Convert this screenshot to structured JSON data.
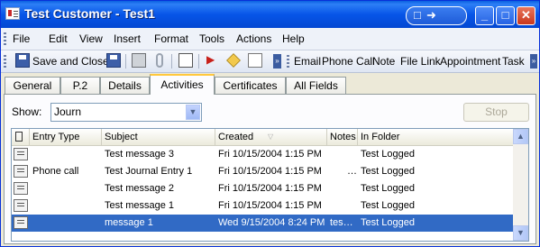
{
  "window": {
    "title": "Test Customer - Test1"
  },
  "menubar": {
    "items": [
      "File",
      "Edit",
      "View",
      "Insert",
      "Format",
      "Tools",
      "Actions",
      "Help"
    ]
  },
  "toolbar": {
    "save_close": "Save and Close",
    "links": [
      "Email",
      "Phone Call",
      "Note",
      "File Link",
      "Appointment",
      "Task"
    ]
  },
  "tabs": [
    "General",
    "P.2",
    "Details",
    "Activities",
    "Certificates",
    "All Fields"
  ],
  "active_tab": "Activities",
  "show": {
    "label": "Show:",
    "value": "Journ"
  },
  "stop_label": "Stop",
  "grid": {
    "columns": [
      "Entry Type",
      "Subject",
      "Created",
      "Notes",
      "In Folder"
    ],
    "rows": [
      {
        "entry_type": "",
        "subject": "Test message 3",
        "created": "Fri 10/15/2004 1:15 PM",
        "notes": "",
        "folder": "Test Logged"
      },
      {
        "entry_type": "Phone call",
        "subject": "Test Journal Entry 1",
        "created": "Fri 10/15/2004 1:15 PM",
        "notes": "…",
        "folder": "Test Logged"
      },
      {
        "entry_type": "",
        "subject": "Test message 2",
        "created": "Fri 10/15/2004 1:15 PM",
        "notes": "",
        "folder": "Test Logged"
      },
      {
        "entry_type": "",
        "subject": "Test message 1",
        "created": "Fri 10/15/2004 1:15 PM",
        "notes": "",
        "folder": "Test Logged"
      },
      {
        "entry_type": "",
        "subject": "message 1",
        "created": "Wed 9/15/2004 8:24 PM",
        "notes": "tes…",
        "folder": "Test Logged"
      }
    ],
    "selected_row": 4
  },
  "colors": {
    "titlebar": "#0755e8",
    "selection": "#316ac5",
    "active_tab_accent": "#ffc83c"
  }
}
